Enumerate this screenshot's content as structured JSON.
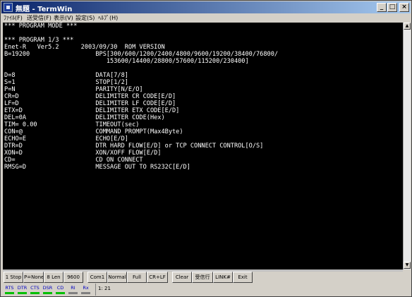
{
  "window": {
    "title": "無題 - TermWin",
    "controls": [
      "_",
      "□",
      "×"
    ]
  },
  "menu": [
    "ﾌｧｲﾙ(F)",
    "送受信(F)",
    "表示(V)",
    "設定(S)",
    "ﾍﾙﾌﾟ(H)"
  ],
  "terminal": {
    "lines": [
      "*** PROGRAM MODE ***",
      "",
      "*** PROGRAM 1/3 ***",
      "Enet-R   Ver5.2      2003/09/30  ROM VERSION",
      "B=19200                  BPS[300/600/1200/2400/4800/9600/19200/38400/76800/",
      "                            153600/14400/28800/57600/115200/230400]",
      "",
      "D=8                      DATA[7/8]",
      "S=1                      STOP[1/2]",
      "P=N                      PARITY[N/E/O]",
      "CR=D                     DELIMITER CR CODE[E/D]",
      "LF=D                     DELIMITER LF CODE[E/D]",
      "ETX=D                    DELIMITER ETX CODE[E/D]",
      "DEL=0A                   DELIMITER CODE(Hex)",
      "TIM= 0.00                TIMEOUT(sec)",
      "CON=@                    COMMAND PROMPT(Max4Byte)",
      "ECHO=E                   ECHO[E/D]",
      "DTR=D                    DTR HARD FLOW[E/D] or TCP CONNECT CONTROL[O/S]",
      "XON=D                    XON/XOFF FLOW[E/D]",
      "CD=                      CD ON CONNECT",
      "RMSG=D                   MESSAGE OUT TO RS232C[E/D]"
    ]
  },
  "toolbar": [
    "1 Stop",
    "P=None",
    "8 Len",
    "9600",
    "Com1",
    "Normal",
    "Full",
    "CR+LF",
    "Clear",
    "受信行",
    "LINK#",
    "Exit"
  ],
  "status": {
    "leds": [
      {
        "label": "RTS",
        "on": true
      },
      {
        "label": "DTR",
        "on": true
      },
      {
        "label": "CTS",
        "on": true
      },
      {
        "label": "DSR",
        "on": true
      },
      {
        "label": "CD",
        "on": true
      },
      {
        "label": "RI",
        "on": false
      },
      {
        "label": "Rx",
        "on": false
      }
    ],
    "cursor": "1:  21"
  },
  "colors": {
    "terminal_bg": "#000000",
    "terminal_fg": "#ffffff",
    "title_start": "#0a246a",
    "title_end": "#a6caf0",
    "led_on": "#00c000",
    "led_off": "#808080"
  }
}
